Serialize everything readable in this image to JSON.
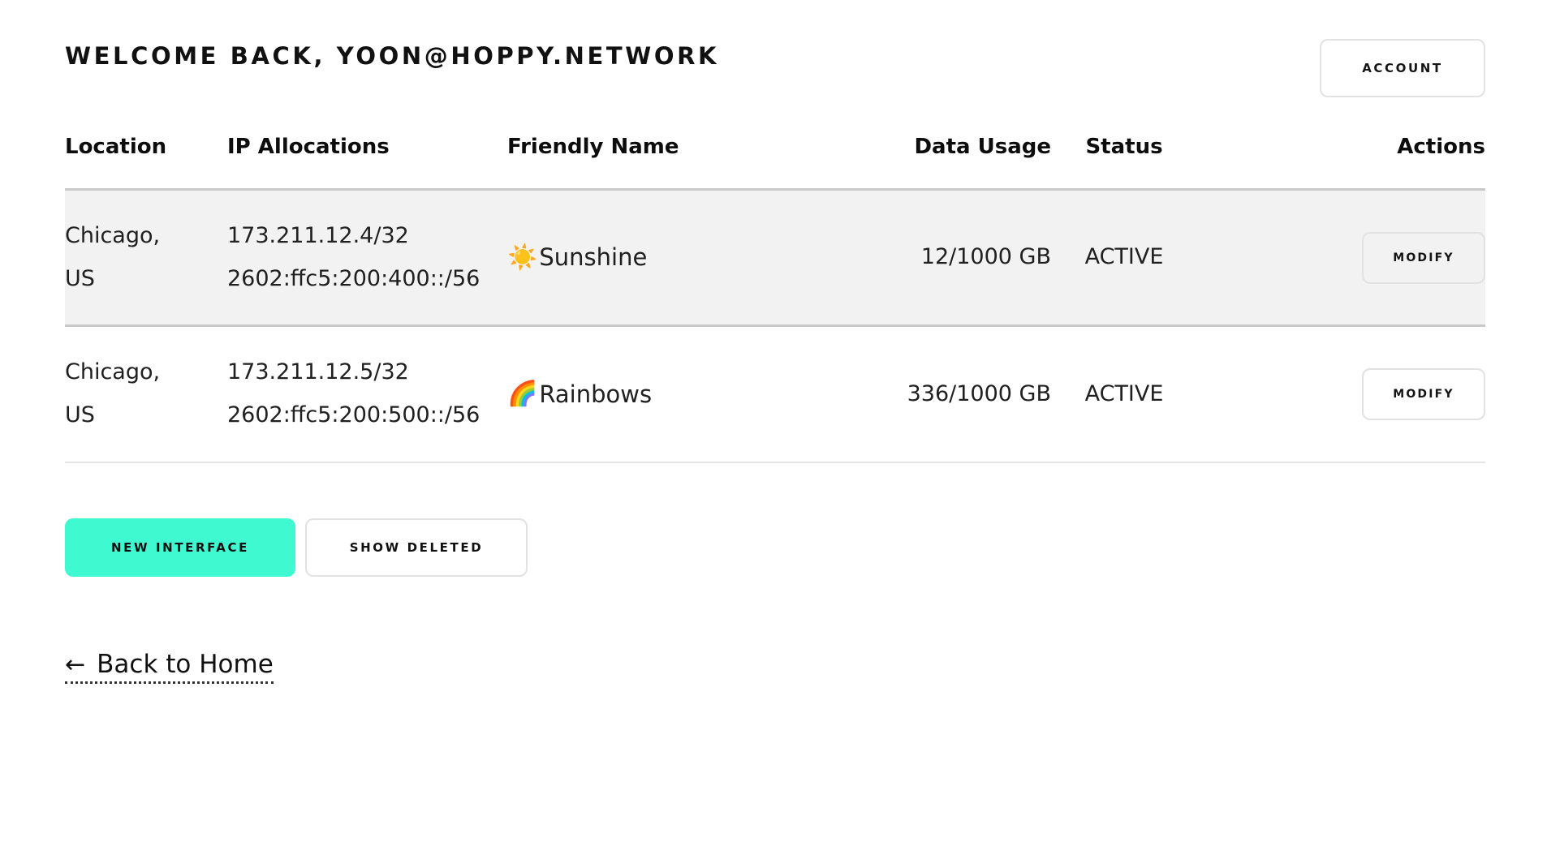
{
  "header": {
    "welcome_title": "WELCOME BACK, YOON@HOPPY.NETWORK",
    "account_label": "ACCOUNT"
  },
  "table": {
    "columns": [
      {
        "key": "location",
        "label": "Location"
      },
      {
        "key": "ip",
        "label": "IP Allocations"
      },
      {
        "key": "friendly",
        "label": "Friendly Name"
      },
      {
        "key": "usage",
        "label": "Data Usage"
      },
      {
        "key": "status",
        "label": "Status"
      },
      {
        "key": "actions",
        "label": "Actions"
      }
    ],
    "rows": [
      {
        "location_line1": "Chicago,",
        "location_line2": "US",
        "ip_v4": "173.211.12.4/32",
        "ip_v6": "2602:ffc5:200:400::/56",
        "friendly_emoji": "☀️",
        "friendly_emoji_name": "sun-emoji",
        "friendly_name": "Sunshine",
        "data_usage": "12/1000 GB",
        "status": "ACTIVE",
        "action_label": "MODIFY",
        "highlighted": true
      },
      {
        "location_line1": "Chicago,",
        "location_line2": "US",
        "ip_v4": "173.211.12.5/32",
        "ip_v6": "2602:ffc5:200:500::/56",
        "friendly_emoji": "🌈",
        "friendly_emoji_name": "rainbow-emoji",
        "friendly_name": "Rainbows",
        "data_usage": "336/1000 GB",
        "status": "ACTIVE",
        "action_label": "MODIFY",
        "highlighted": false
      }
    ]
  },
  "footer": {
    "new_interface_label": "NEW INTERFACE",
    "show_deleted_label": "SHOW DELETED",
    "back_arrow": "←",
    "back_label": "Back to Home"
  },
  "colors": {
    "accent": "#3FF9D0",
    "row_highlight": "#F2F2F2",
    "border_strong": "#C9C9C9",
    "border_light": "#E2E2E2",
    "text": "#111111"
  }
}
